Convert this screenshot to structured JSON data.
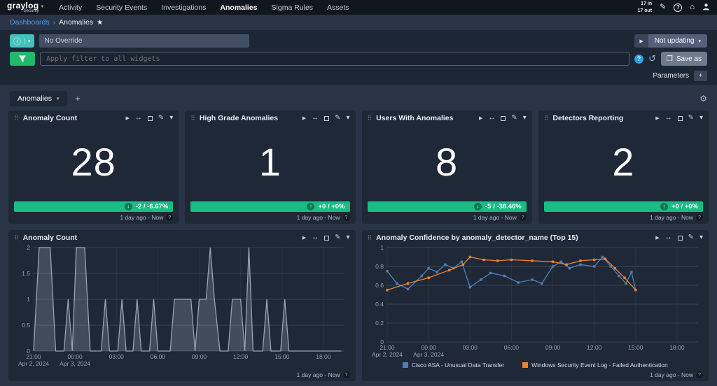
{
  "icons": {
    "play": "▶",
    "move": "↔",
    "edit": "✎",
    "caret": "▾",
    "drag": "⠿",
    "gear": "⚙",
    "star": "★",
    "home": "⌂",
    "history": "↺",
    "copy": "❐",
    "info": "ⓘ",
    "question": "?",
    "plus": "+",
    "compose": "✎",
    "sep": "›"
  },
  "nav": {
    "brand": "graylog",
    "brand_sub": "Security",
    "items": [
      {
        "label": "Activity"
      },
      {
        "label": "Security Events"
      },
      {
        "label": "Investigations"
      },
      {
        "label": "Anomalies"
      },
      {
        "label": "Sigma Rules"
      },
      {
        "label": "Assets"
      }
    ],
    "throughput_in": "17 in",
    "throughput_out": "17 out"
  },
  "breadcrumb": {
    "root": "Dashboards",
    "current": "Anomalies"
  },
  "searchbar": {
    "override_value": "No Override",
    "not_updating": "Not updating",
    "filter_placeholder": "Apply filter to all widgets",
    "save_as": "Save as",
    "parameters": "Parameters"
  },
  "tabs": {
    "active": "Anomalies"
  },
  "numeric_widgets": [
    {
      "title": "Anomaly Count",
      "value": "28",
      "arrow": "↓",
      "delta": "-2 / -6.67%",
      "timerange": "1 day ago - Now"
    },
    {
      "title": "High Grade Anomalies",
      "value": "1",
      "arrow": "↑",
      "delta": "+0 / +0%",
      "timerange": "1 day ago - Now"
    },
    {
      "title": "Users With Anomalies",
      "value": "8",
      "arrow": "↓",
      "delta": "-5 / -38.46%",
      "timerange": "1 day ago - Now"
    },
    {
      "title": "Detectors Reporting",
      "value": "2",
      "arrow": "↑",
      "delta": "+0 / +0%",
      "timerange": "1 day ago - Now"
    }
  ],
  "chart_widgets": [
    {
      "title": "Anomaly Count",
      "timerange": "1 day ago - Now"
    },
    {
      "title": "Anomaly Confidence by anomaly_detector_name (Top 15)",
      "timerange": "1 day ago - Now"
    }
  ],
  "chart_data": [
    {
      "type": "area",
      "title": "Anomaly Count",
      "xlabel": "",
      "ylabel": "",
      "xlim": [
        0,
        22.5
      ],
      "ylim": [
        0,
        2
      ],
      "y_ticks": [
        0,
        0.5,
        1,
        1.5,
        2
      ],
      "grid": true,
      "x_ticks": [
        {
          "pos": 0,
          "label": "21:00",
          "sub": "Apr 2, 2024"
        },
        {
          "pos": 3,
          "label": "00:00",
          "sub": "Apr 3, 2024"
        },
        {
          "pos": 6,
          "label": "03:00"
        },
        {
          "pos": 9,
          "label": "06:00"
        },
        {
          "pos": 12,
          "label": "09:00"
        },
        {
          "pos": 15,
          "label": "12:00"
        },
        {
          "pos": 18,
          "label": "15:00"
        },
        {
          "pos": 21,
          "label": "18:00"
        }
      ],
      "series": [
        {
          "name": "Anomaly Count",
          "color": "#9aa3b2",
          "fill": "rgba(150,158,172,0.30)",
          "markers": false,
          "points": [
            [
              0,
              0
            ],
            [
              0.4,
              2
            ],
            [
              1.2,
              2
            ],
            [
              1.6,
              0
            ],
            [
              2.2,
              0
            ],
            [
              2.5,
              1
            ],
            [
              2.8,
              0
            ],
            [
              3.1,
              2
            ],
            [
              3.7,
              2
            ],
            [
              4.1,
              0
            ],
            [
              4.9,
              0
            ],
            [
              5.2,
              1
            ],
            [
              5.5,
              0
            ],
            [
              6.1,
              0
            ],
            [
              6.4,
              1
            ],
            [
              6.7,
              0
            ],
            [
              7.2,
              0
            ],
            [
              7.5,
              1
            ],
            [
              7.8,
              0
            ],
            [
              8.4,
              0
            ],
            [
              8.7,
              1
            ],
            [
              9,
              0
            ],
            [
              9.9,
              0
            ],
            [
              10.2,
              1
            ],
            [
              11.4,
              1
            ],
            [
              11.7,
              0
            ],
            [
              12,
              1
            ],
            [
              12.5,
              1
            ],
            [
              12.8,
              2
            ],
            [
              13.1,
              1
            ],
            [
              13.5,
              0
            ],
            [
              14.1,
              0
            ],
            [
              14.4,
              1
            ],
            [
              15,
              1
            ],
            [
              15.3,
              0
            ],
            [
              15.6,
              2
            ],
            [
              15.9,
              0
            ],
            [
              16.6,
              0
            ],
            [
              16.9,
              1
            ],
            [
              17.2,
              0
            ],
            [
              17.9,
              0
            ],
            [
              18.2,
              1
            ],
            [
              18.5,
              0
            ],
            [
              22.3,
              0
            ]
          ]
        }
      ]
    },
    {
      "type": "line",
      "title": "Anomaly Confidence by anomaly_detector_name (Top 15)",
      "xlabel": "",
      "ylabel": "",
      "xlim": [
        0,
        22.5
      ],
      "ylim": [
        0,
        1
      ],
      "y_ticks": [
        0,
        0.2,
        0.4,
        0.6,
        0.8,
        1
      ],
      "grid": true,
      "legend_position": "bottom",
      "x_ticks": [
        {
          "pos": 0,
          "label": "21:00",
          "sub": "Apr 2, 2024"
        },
        {
          "pos": 3,
          "label": "00:00",
          "sub": "Apr 3, 2024"
        },
        {
          "pos": 6,
          "label": "03:00"
        },
        {
          "pos": 9,
          "label": "06:00"
        },
        {
          "pos": 12,
          "label": "09:00"
        },
        {
          "pos": 15,
          "label": "12:00"
        },
        {
          "pos": 18,
          "label": "15:00"
        },
        {
          "pos": 21,
          "label": "18:00"
        }
      ],
      "series": [
        {
          "name": "Cisco ASA - Unusual Data Transfer",
          "color": "#4f7fbe",
          "markers": true,
          "points": [
            [
              0,
              0.75
            ],
            [
              0.7,
              0.62
            ],
            [
              1.5,
              0.56
            ],
            [
              2.5,
              0.7
            ],
            [
              3,
              0.78
            ],
            [
              3.6,
              0.74
            ],
            [
              4.2,
              0.82
            ],
            [
              4.8,
              0.78
            ],
            [
              5.4,
              0.85
            ],
            [
              6,
              0.58
            ],
            [
              6.8,
              0.66
            ],
            [
              7.5,
              0.73
            ],
            [
              8.5,
              0.7
            ],
            [
              9.5,
              0.63
            ],
            [
              10.5,
              0.66
            ],
            [
              11.2,
              0.62
            ],
            [
              12,
              0.8
            ],
            [
              12.6,
              0.85
            ],
            [
              13.2,
              0.78
            ],
            [
              14,
              0.82
            ],
            [
              15,
              0.8
            ],
            [
              15.6,
              0.9
            ],
            [
              16.2,
              0.8
            ],
            [
              16.8,
              0.7
            ],
            [
              17.3,
              0.62
            ],
            [
              17.7,
              0.74
            ],
            [
              18,
              0.55
            ]
          ]
        },
        {
          "name": "Windows Security Event Log - Failed Authentication",
          "color": "#ee8430",
          "markers": true,
          "points": [
            [
              0,
              0.55
            ],
            [
              1.5,
              0.62
            ],
            [
              3,
              0.68
            ],
            [
              4.5,
              0.76
            ],
            [
              5.5,
              0.82
            ],
            [
              6,
              0.9
            ],
            [
              7,
              0.87
            ],
            [
              8,
              0.86
            ],
            [
              9,
              0.87
            ],
            [
              10.5,
              0.86
            ],
            [
              12,
              0.85
            ],
            [
              13,
              0.82
            ],
            [
              14,
              0.86
            ],
            [
              15,
              0.87
            ],
            [
              15.8,
              0.88
            ],
            [
              16.5,
              0.78
            ],
            [
              17.2,
              0.68
            ],
            [
              18,
              0.55
            ]
          ]
        }
      ]
    }
  ]
}
